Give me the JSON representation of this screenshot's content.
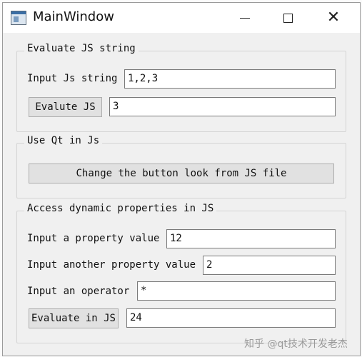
{
  "window": {
    "title": "MainWindow",
    "controls": {
      "minimize": "minimize-icon",
      "maximize": "maximize-icon",
      "close": "close-icon"
    }
  },
  "evaluate_group": {
    "title": "Evaluate JS string",
    "input_label": "Input Js string",
    "input_value": "1,2,3",
    "button_label": "Evalute JS",
    "result_value": "3"
  },
  "qt_group": {
    "title": "Use Qt in Js",
    "button_label": "Change the button look from JS file"
  },
  "dynamic_group": {
    "title": "Access dynamic properties in JS",
    "property_label": "Input a property value",
    "property_value": "12",
    "another_label": "Input another property value",
    "another_value": "2",
    "operator_label": "Input an operator",
    "operator_value": "*",
    "button_label": "Evaluate in JS",
    "result_value": "24"
  },
  "watermark": "知乎 @qt技术开发老杰"
}
